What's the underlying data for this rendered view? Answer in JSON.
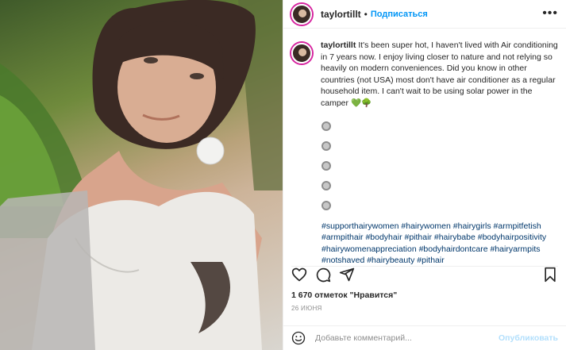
{
  "post": {
    "username": "taylortillt",
    "follow_label": "Подписаться",
    "separator": "•",
    "more_label": "•••"
  },
  "caption": {
    "username": "taylortillt",
    "text": "It's been super hot, I haven't lived with Air conditioning in 7 years now. I enjoy living closer to nature and not relying so heavily on modern conveniences. Did you know in other countries (not USA) most don't have air conditioner as a regular household item. I can't wait to be using solar power in the camper",
    "emoji": "💚🌳"
  },
  "hashtags": [
    "#supporthairywomen",
    "#hairywomen",
    "#hairygirls",
    "#armpitfetish",
    "#armpithair",
    "#bodyhair",
    "#pithair",
    "#hairybabe",
    "#bodyhairpositivity",
    "#hairywomenappreciation",
    "#bodyhairdontcare",
    "#hairyarmpits",
    "#notshaved",
    "#hairybeauty",
    "#pithair"
  ],
  "likes": {
    "text": "1 670 отметок \"Нравится\""
  },
  "date": "26 ИЮНЯ",
  "comment_box": {
    "placeholder": "Добавьте комментарий...",
    "publish_label": "Опубликовать"
  },
  "icons": {
    "like": "heart-icon",
    "comment": "comment-icon",
    "share": "share-icon",
    "save": "bookmark-icon",
    "emoji": "smiley-icon"
  },
  "colors": {
    "link": "#00376b",
    "follow": "#0095f6",
    "publish_disabled": "#b2dffc",
    "muted": "#8e8e8e"
  }
}
